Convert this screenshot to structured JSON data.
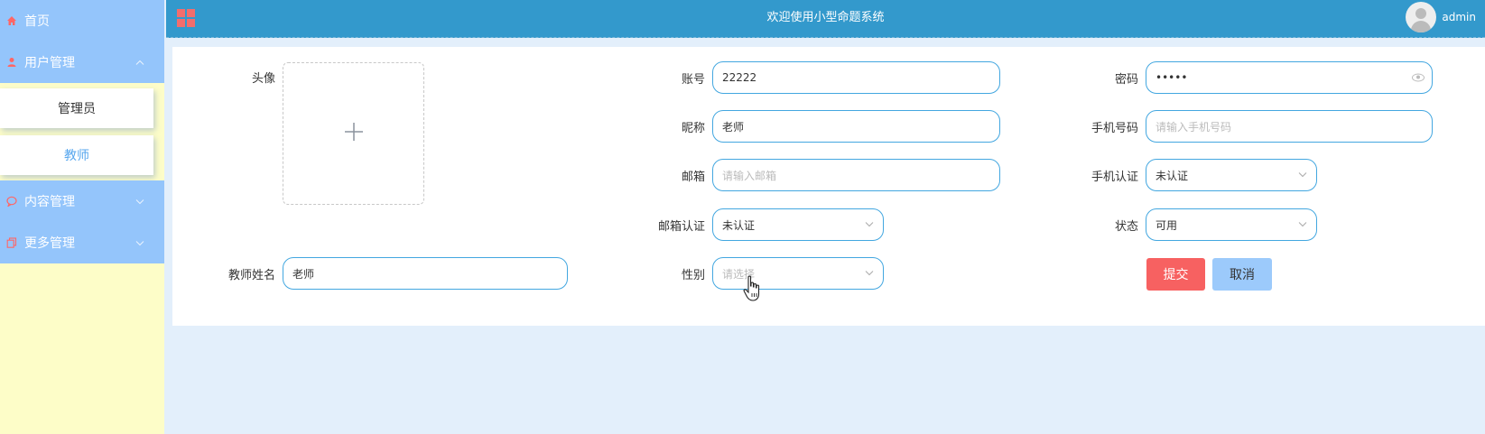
{
  "sidebar": {
    "items": [
      {
        "label": "首页",
        "icon": "home-icon"
      },
      {
        "label": "用户管理",
        "icon": "user-icon",
        "expanded": true,
        "children": [
          {
            "label": "管理员",
            "active": false
          },
          {
            "label": "教师",
            "active": true
          }
        ]
      },
      {
        "label": "内容管理",
        "icon": "chat-icon",
        "expanded": false
      },
      {
        "label": "更多管理",
        "icon": "copy-icon",
        "expanded": false
      }
    ]
  },
  "header": {
    "title": "欢迎使用小型命题系统",
    "username": "admin"
  },
  "form": {
    "avatar_label": "头像",
    "teacher_name": {
      "label": "教师姓名",
      "value": "老师"
    },
    "account": {
      "label": "账号",
      "value": "22222"
    },
    "nickname": {
      "label": "昵称",
      "value": "老师"
    },
    "email": {
      "label": "邮箱",
      "placeholder": "请输入邮箱"
    },
    "email_verify": {
      "label": "邮箱认证",
      "value": "未认证"
    },
    "gender": {
      "label": "性别",
      "placeholder": "请选择"
    },
    "password": {
      "label": "密码",
      "value": "•••••"
    },
    "phone": {
      "label": "手机号码",
      "placeholder": "请输入手机号码"
    },
    "phone_verify": {
      "label": "手机认证",
      "value": "未认证"
    },
    "status": {
      "label": "状态",
      "value": "可用"
    },
    "submit_label": "提交",
    "cancel_label": "取消"
  },
  "colors": {
    "header_bg": "#3399cc",
    "sidebar_menu_bg": "#94c5fb",
    "sidebar_bg": "#fdfdc8",
    "content_bg": "#e3effb",
    "input_border": "#43a7e0",
    "submit_bg": "#f76161",
    "cancel_bg": "#9ccafb"
  }
}
